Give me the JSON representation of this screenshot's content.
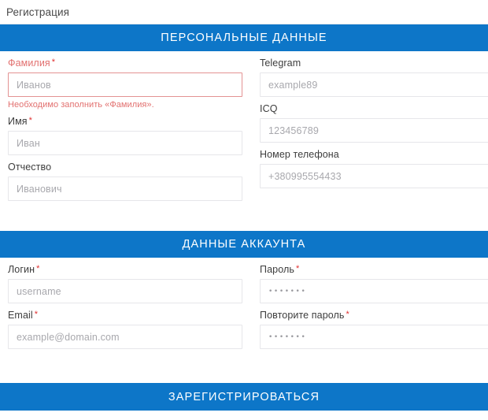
{
  "page": {
    "title": "Регистрация"
  },
  "sections": [
    {
      "header": "ПЕРСОНАЛЬНЫЕ ДАННЫЕ",
      "left_fields": [
        {
          "label": "Фамилия",
          "required": true,
          "placeholder": "Иванов",
          "state": "error",
          "error": "Необходимо заполнить «Фамилия»."
        },
        {
          "label": "Имя",
          "required": true,
          "placeholder": "Иван",
          "state": "normal"
        },
        {
          "label": "Отчество",
          "required": false,
          "placeholder": "Иванович",
          "state": "normal"
        }
      ],
      "right_fields": [
        {
          "label": "Telegram",
          "required": false,
          "placeholder": "example89",
          "state": "normal"
        },
        {
          "label": "ICQ",
          "required": false,
          "placeholder": "123456789",
          "state": "normal"
        },
        {
          "label": "Номер телефона",
          "required": false,
          "placeholder": "+380995554433",
          "state": "normal"
        }
      ]
    },
    {
      "header": "ДАННЫЕ АККАУНТА",
      "left_fields": [
        {
          "label": "Логин",
          "required": true,
          "placeholder": "username",
          "state": "normal"
        },
        {
          "label": "Email",
          "required": true,
          "placeholder": "example@domain.com",
          "state": "normal"
        }
      ],
      "right_fields": [
        {
          "label": "Пароль",
          "required": true,
          "placeholder": "•••••••",
          "type": "password",
          "state": "normal"
        },
        {
          "label": "Повторите пароль",
          "required": true,
          "placeholder": "•••••••",
          "type": "password",
          "state": "normal"
        }
      ]
    }
  ],
  "submit": {
    "label": "ЗАРЕГИСТРИРОВАТЬСЯ"
  },
  "colors": {
    "accent_blue": "#0d76c8",
    "error_red": "#e2706f",
    "required_star": "#e03131",
    "input_border": "#e6e6ea",
    "error_border": "#e39293",
    "placeholder": "#a8a8ad",
    "label": "#3d3d3d"
  }
}
